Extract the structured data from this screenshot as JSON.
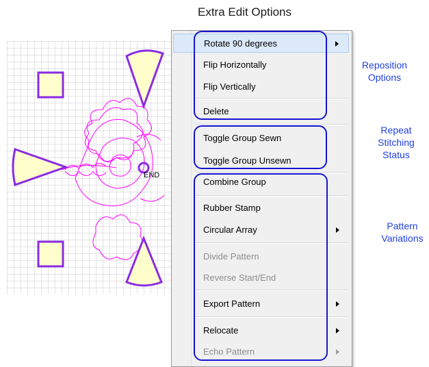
{
  "title": "Extra Edit Options",
  "canvas_label": "END",
  "menu": {
    "items": [
      {
        "label": "Rotate 90 degrees",
        "submenu": true,
        "enabled": true
      },
      {
        "label": "Flip Horizontally",
        "submenu": false,
        "enabled": true
      },
      {
        "label": "Flip Vertically",
        "submenu": false,
        "enabled": true
      },
      {
        "label": "Delete",
        "submenu": false,
        "enabled": true
      },
      {
        "label": "Toggle Group Sewn",
        "submenu": false,
        "enabled": true
      },
      {
        "label": "Toggle Group Unsewn",
        "submenu": false,
        "enabled": true
      },
      {
        "label": "Combine Group",
        "submenu": false,
        "enabled": true
      },
      {
        "label": "Rubber Stamp",
        "submenu": false,
        "enabled": true
      },
      {
        "label": "Circular Array",
        "submenu": true,
        "enabled": true
      },
      {
        "label": "Divide Pattern",
        "submenu": false,
        "enabled": false
      },
      {
        "label": "Reverse Start/End",
        "submenu": false,
        "enabled": false
      },
      {
        "label": "Export Pattern",
        "submenu": true,
        "enabled": true
      },
      {
        "label": "Relocate",
        "submenu": true,
        "enabled": true
      },
      {
        "label": "Echo Pattern",
        "submenu": true,
        "enabled": false
      }
    ]
  },
  "annotations": {
    "reposition_line1": "Reposition",
    "reposition_line2": "Options",
    "repeat_line1": "Repeat",
    "repeat_line2": "Stitching",
    "repeat_line3": "Status",
    "pattern_line1": "Pattern",
    "pattern_line2": "Variations"
  },
  "colors": {
    "annotation_blue": "#1f3fe0",
    "group_box_blue": "#1414d2",
    "shape_purple": "#8a2be2",
    "pattern_magenta": "#ff00ff",
    "shape_fill": "#ffffcc",
    "highlight_bg": "#dce9f8"
  }
}
